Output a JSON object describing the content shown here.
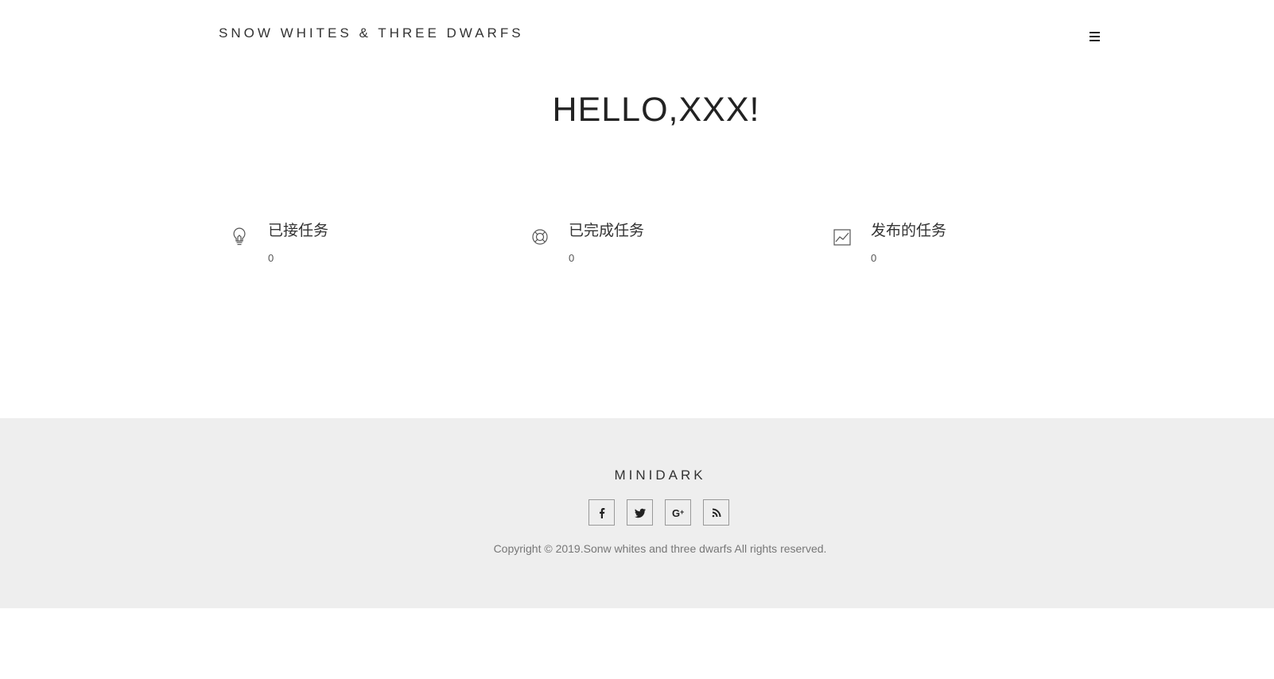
{
  "header": {
    "brand": "SNOW WHITES & THREE DWARFS",
    "menu_icon": "hamburger-menu-icon"
  },
  "hero": {
    "title": "HELLO,XXX!"
  },
  "stats": [
    {
      "icon": "lightbulb-icon",
      "label": "已接任务",
      "value": "0"
    },
    {
      "icon": "lifebuoy-icon",
      "label": "已完成任务",
      "value": "0"
    },
    {
      "icon": "line-chart-icon",
      "label": "发布的任务",
      "value": "0"
    }
  ],
  "footer": {
    "title": "MINIDARK",
    "social": [
      {
        "icon": "facebook-icon"
      },
      {
        "icon": "twitter-icon"
      },
      {
        "icon": "google-plus-icon"
      },
      {
        "icon": "rss-icon"
      }
    ],
    "copyright": "Copyright © 2019.Sonw whites and three dwarfs All rights reserved."
  },
  "colors": {
    "footer_bg": "#eeeeee",
    "text": "#333333"
  }
}
